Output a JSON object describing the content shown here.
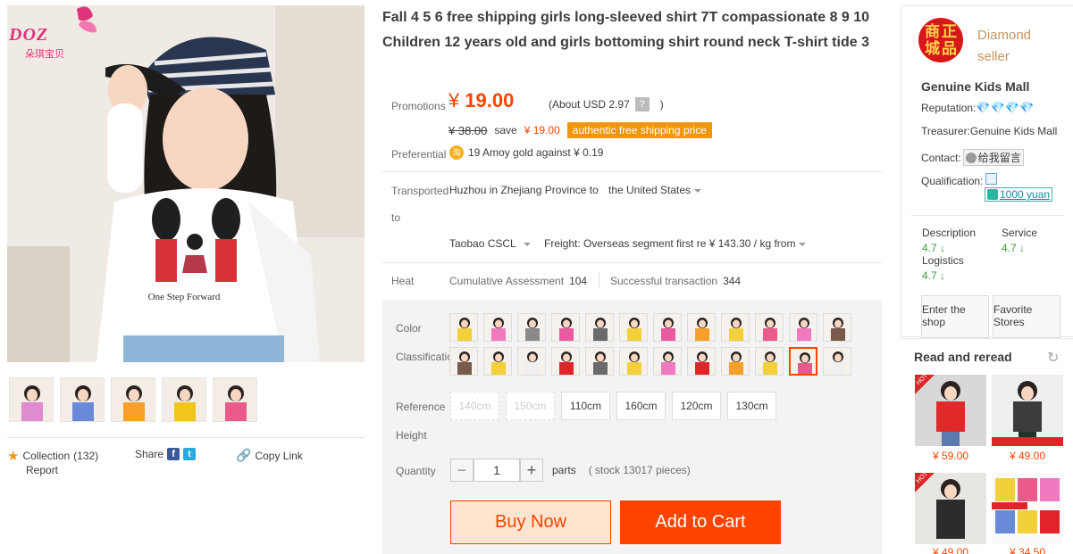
{
  "brand": {
    "name": "DOZ",
    "subtitle": "朵琪宝贝"
  },
  "main_image_text": "One Step Forward",
  "gallery": {
    "thumbs": [
      "#e08ad0",
      "#6a8ad8",
      "#f6a02a",
      "#f2c41e",
      "#ea5a8a"
    ]
  },
  "left_actions": {
    "collection_label": "Collection",
    "collection_count": "(132)",
    "report_label": "Report",
    "share_label": "Share",
    "copy_link_label": "Copy Link"
  },
  "product": {
    "title": "Fall 4 5 6 free shipping girls long-sleeved shirt 7T compassionate 8 9 10 Children 12 years old and girls bottoming shirt round neck T-shirt tide 3",
    "promotions_label": "Promotions",
    "currency": "¥",
    "price": "19.00",
    "about_usd": "(About USD 2.97",
    "about_usd_end": ")",
    "help_mark": "?",
    "original_price": "¥ 38.00",
    "save_label": "save",
    "save_amount": "¥ 19.00",
    "free_shipping_badge": "authentic free shipping price",
    "preferential_label": "Preferential",
    "gold_icon": "淘",
    "preferential_text": "19 Amoy gold against ¥ 0.19"
  },
  "shipping": {
    "transported_label": "Transported",
    "to_label": "to",
    "from": "Huzhou in Zhejiang Province to",
    "destination": "the United States",
    "carrier": "Taobao CSCL",
    "freight": "Freight: Overseas segment first re ¥ 143.30 / kg from"
  },
  "heat": {
    "label": "Heat",
    "cumulative_label": "Cumulative Assessment",
    "cumulative_value": "104",
    "successful_label": "Successful transaction",
    "successful_value": "344"
  },
  "options": {
    "color_label": "Color",
    "classification_label": "Classification",
    "swatches_row1": [
      "#f2d03a",
      "#f07ac0",
      "#8a8a8a",
      "#ea5aa0",
      "#6a6a6a",
      "#f2d03a",
      "#ea5aa0",
      "#f6a02a",
      "#f2d03a",
      "#ea5a8a",
      "#f07ac0",
      "#7a5a4a"
    ],
    "swatches_row2": [
      "#7a5a4a",
      "#f2d03a",
      "#f0f0f0",
      "#e0242a",
      "#6a6a6a",
      "#f2d03a",
      "#f07ac0",
      "#e0242a",
      "#f6a02a",
      "#f2d03a",
      "#ea5a8a",
      "#f0f0f0"
    ],
    "selected_swatch": "row2-10",
    "reference_label": "Reference",
    "height_label": "Height",
    "sizes": [
      {
        "label": "140cm",
        "disabled": true
      },
      {
        "label": "150cm",
        "disabled": true
      },
      {
        "label": "110cm",
        "disabled": false
      },
      {
        "label": "160cm",
        "disabled": false
      },
      {
        "label": "120cm",
        "disabled": false
      },
      {
        "label": "130cm",
        "disabled": false
      }
    ],
    "quantity_label": "Quantity",
    "quantity_minus": "−",
    "quantity_value": "1",
    "quantity_plus": "+",
    "quantity_unit": "parts",
    "stock_text": "( stock 13017 pieces)"
  },
  "actions": {
    "buy_now": "Buy Now",
    "add_to_cart": "Add to Cart"
  },
  "seller": {
    "logo_chars": [
      "商",
      "正",
      "城",
      "品"
    ],
    "badge_text": "Diamond seller",
    "shop_name": "Genuine Kids Mall",
    "reputation_label": "Reputation:",
    "reputation_diamonds": "💎💎💎💎",
    "treasurer_label": "Treasurer:",
    "treasurer_value": "Genuine Kids Mall",
    "contact_label": "Contact:",
    "contact_value": "给我留言",
    "qualification_label": "Qualification:",
    "deposit": "1000 yuan",
    "description_label": "Description",
    "description_score": "4.7",
    "service_label": "Service",
    "service_score": "4.7",
    "logistics_label": "Logistics",
    "logistics_score": "4.7",
    "enter_shop": "Enter the shop",
    "favorite_stores": "Favorite Stores"
  },
  "recommend": {
    "title": "Read and reread",
    "hot_label": "HOT",
    "items": [
      {
        "price": "¥ 59.00",
        "color": "#e02a2a"
      },
      {
        "price": "¥ 49.00",
        "color": "#3c3c3c"
      },
      {
        "price": "¥ 49.00",
        "color": "#2c2c2c"
      },
      {
        "price": "¥ 34.50",
        "color": "#f2d03a"
      }
    ]
  }
}
